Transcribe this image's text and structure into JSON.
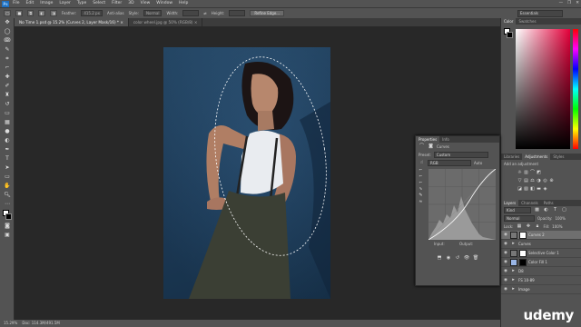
{
  "menubar": {
    "logo": "Ps",
    "items": [
      "File",
      "Edit",
      "Image",
      "Layer",
      "Type",
      "Select",
      "Filter",
      "3D",
      "View",
      "Window",
      "Help"
    ],
    "controls": [
      "—",
      "❐",
      "✕"
    ]
  },
  "options": {
    "feather_label": "Feather:",
    "feather_value": "415.2 px",
    "antialias": "Anti-alias",
    "style_label": "Style:",
    "style_value": "Normal",
    "width_label": "Width:",
    "height_label": "Height:",
    "refine": "Refine Edge...",
    "workspace": "Essentials"
  },
  "doctabs": [
    {
      "label": "No Time 1.psd @ 15.2% (Curves 2, Layer Mask/16) *  ×"
    },
    {
      "label": "color wheel.jpg @ 50% (RGB/8)  ×"
    }
  ],
  "status": {
    "zoom": "15.29%",
    "doc": "Doc: 114.3M/491.5M"
  },
  "colorPanel": {
    "tabs": [
      "Color",
      "Swatches"
    ]
  },
  "adjustments": {
    "tabs": [
      "Libraries",
      "Adjustments",
      "Styles"
    ],
    "title": "Add an adjustment"
  },
  "properties": {
    "tabs": [
      "Properties",
      "Info"
    ],
    "title": "Curves",
    "preset_label": "Preset:",
    "preset_value": "Custom",
    "channel_value": "RGB",
    "auto_label": "Auto",
    "input_label": "Input:",
    "output_label": "Output:"
  },
  "layers": {
    "tabs": [
      "Layers",
      "Channels",
      "Paths"
    ],
    "kind": "Kind",
    "blend": "Normal",
    "opacity_label": "Opacity:",
    "opacity": "100%",
    "lock_label": "Lock:",
    "fill_label": "Fill:",
    "fill": "100%",
    "items": [
      {
        "name": "Curves 2"
      },
      {
        "name": "Curves"
      },
      {
        "name": "Selective Color 1"
      },
      {
        "name": "Color Fill 1"
      },
      {
        "name": "D8"
      },
      {
        "name": "FS 10-89"
      },
      {
        "name": "Image"
      }
    ]
  },
  "watermark": "udemy",
  "colors": {
    "chrome": "#535353",
    "canvas": "#282828",
    "photo_bg": "#1f3f5e"
  }
}
